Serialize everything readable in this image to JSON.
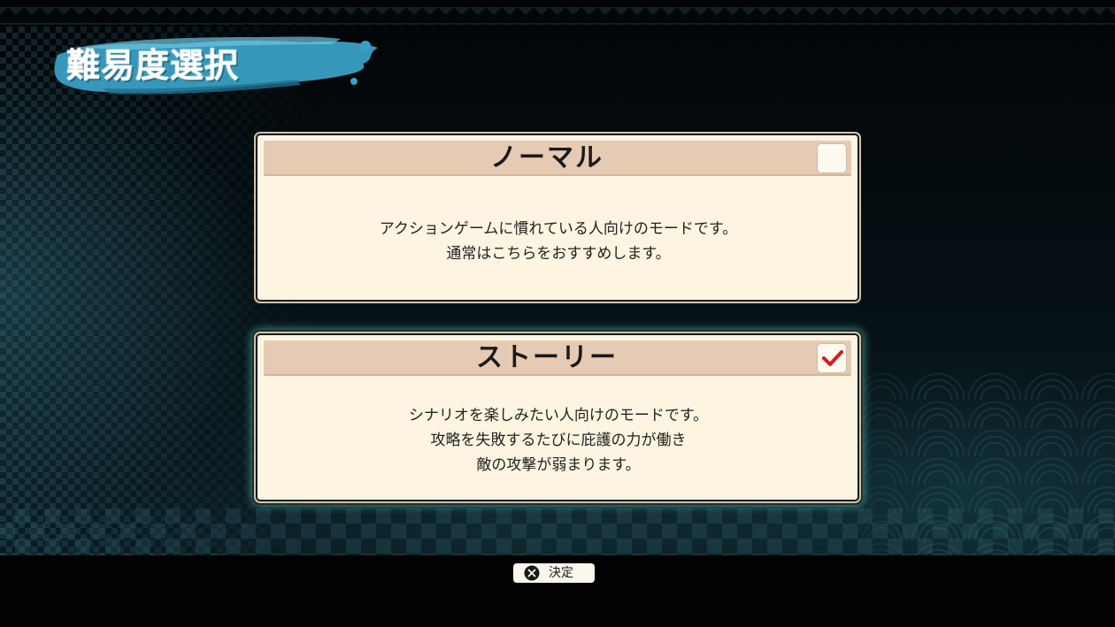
{
  "screen": {
    "title": "難易度選択"
  },
  "options": [
    {
      "name": "ノーマル",
      "selected": false,
      "description": [
        "アクションゲームに慣れている人向けのモードです。",
        "通常はこちらをおすすめします。"
      ]
    },
    {
      "name": "ストーリー",
      "selected": true,
      "description": [
        "シナリオを楽しみたい人向けのモードです。",
        "攻略を失敗するたびに庇護の力が働き",
        "敵の攻撃が弱まります。"
      ]
    }
  ],
  "footer": {
    "confirm_icon": "cross-button-icon",
    "confirm_label": "決定"
  },
  "colors": {
    "card_background": "#fdf5e1",
    "card_header": "#e5cbb3",
    "check_mark": "#d9191f",
    "focus_glow": "#6ee6d2",
    "title_brush": "#3a9fc4"
  }
}
